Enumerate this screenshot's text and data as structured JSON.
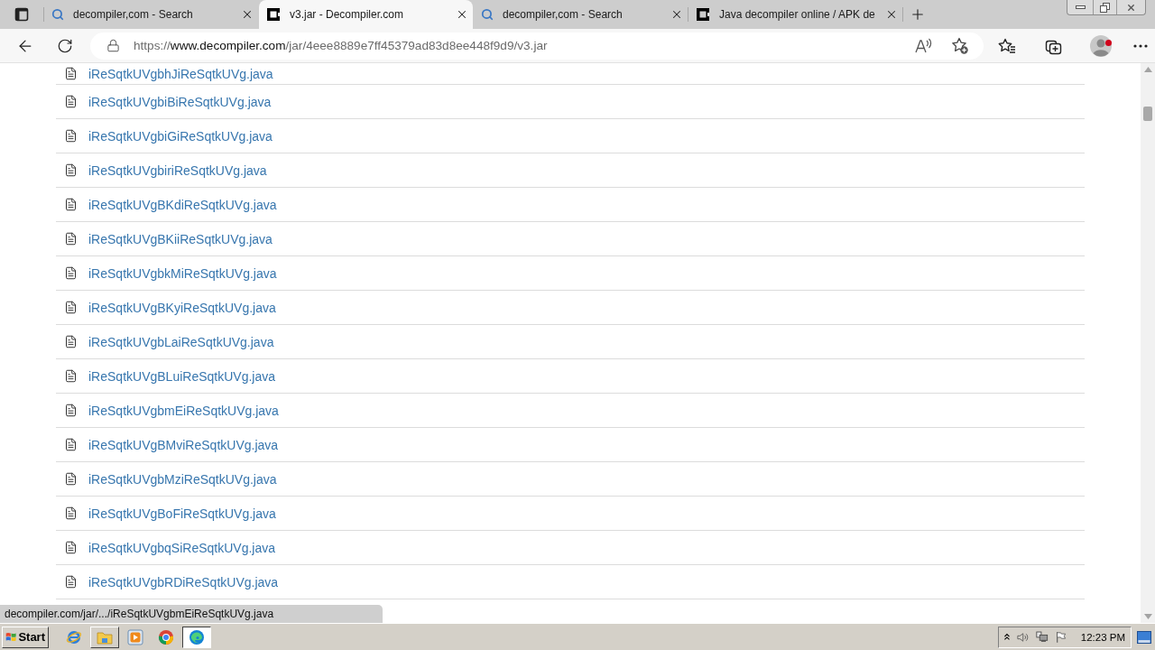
{
  "browser": {
    "tabs": [
      {
        "kind": "search",
        "title": "decompiler,com - Search",
        "selected": false
      },
      {
        "kind": "site",
        "title": "v3.jar - Decompiler.com",
        "selected": true
      },
      {
        "kind": "search",
        "title": "decompiler,com - Search",
        "selected": false
      },
      {
        "kind": "site",
        "title": "Java decompiler online / APK de",
        "selected": false
      }
    ],
    "address": {
      "scheme": "https://",
      "host": "www.decompiler.com",
      "path": "/jar/4eee8889e7ff45379ad83d8ee448f9d9/v3.jar"
    }
  },
  "page": {
    "files": [
      {
        "name": "iReSqtkUVgbhJiReSqtkUVg.java"
      },
      {
        "name": "iReSqtkUVgbiBiReSqtkUVg.java"
      },
      {
        "name": "iReSqtkUVgbiGiReSqtkUVg.java"
      },
      {
        "name": "iReSqtkUVgbiriReSqtkUVg.java"
      },
      {
        "name": "iReSqtkUVgBKdiReSqtkUVg.java"
      },
      {
        "name": "iReSqtkUVgBKiiReSqtkUVg.java"
      },
      {
        "name": "iReSqtkUVgbkMiReSqtkUVg.java"
      },
      {
        "name": "iReSqtkUVgBKyiReSqtkUVg.java"
      },
      {
        "name": "iReSqtkUVgbLaiReSqtkUVg.java"
      },
      {
        "name": "iReSqtkUVgBLuiReSqtkUVg.java"
      },
      {
        "name": "iReSqtkUVgbmEiReSqtkUVg.java"
      },
      {
        "name": "iReSqtkUVgBMviReSqtkUVg.java"
      },
      {
        "name": "iReSqtkUVgbMziReSqtkUVg.java"
      },
      {
        "name": "iReSqtkUVgBoFiReSqtkUVg.java"
      },
      {
        "name": "iReSqtkUVgbqSiReSqtkUVg.java"
      },
      {
        "name": "iReSqtkUVgbRDiReSqtkUVg.java"
      }
    ]
  },
  "status_url": "decompiler.com/jar/.../iReSqtkUVgbmEiReSqtkUVg.java",
  "taskbar": {
    "start": "Start",
    "apps": [
      {
        "kind": "ie",
        "open": false,
        "selected": false
      },
      {
        "kind": "explorer",
        "open": true,
        "selected": false
      },
      {
        "kind": "media",
        "open": false,
        "selected": false
      },
      {
        "kind": "chrome",
        "open": false,
        "selected": false
      },
      {
        "kind": "edge",
        "open": true,
        "selected": true
      }
    ],
    "clock": "12:23 PM"
  }
}
